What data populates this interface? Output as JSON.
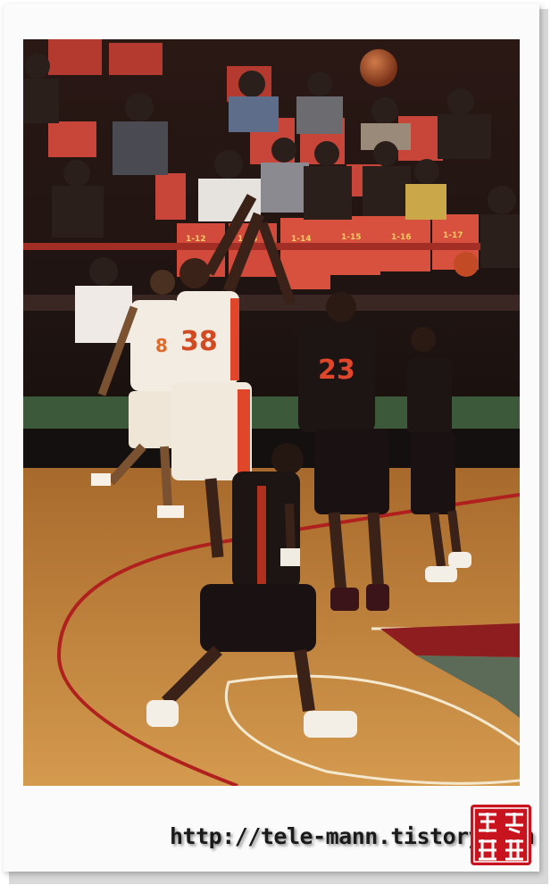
{
  "photo": {
    "subject": "basketball-game-photo",
    "colors": {
      "court": "#c9893d",
      "jersey_home": "#f3ece2",
      "jersey_away": "#1d1414",
      "accent": "#e0462a"
    },
    "jersey_numbers": {
      "white_player": "38",
      "white_teammate": "8",
      "dark_center": "23"
    },
    "seat_labels": [
      "1-12",
      "1-13",
      "1-14",
      "1-15",
      "1-16",
      "1-17"
    ]
  },
  "caption": {
    "url": "http://tele-mann.tistory.com"
  },
  "seal": {
    "color": "#c8141e",
    "chars": "難得糊塗"
  }
}
